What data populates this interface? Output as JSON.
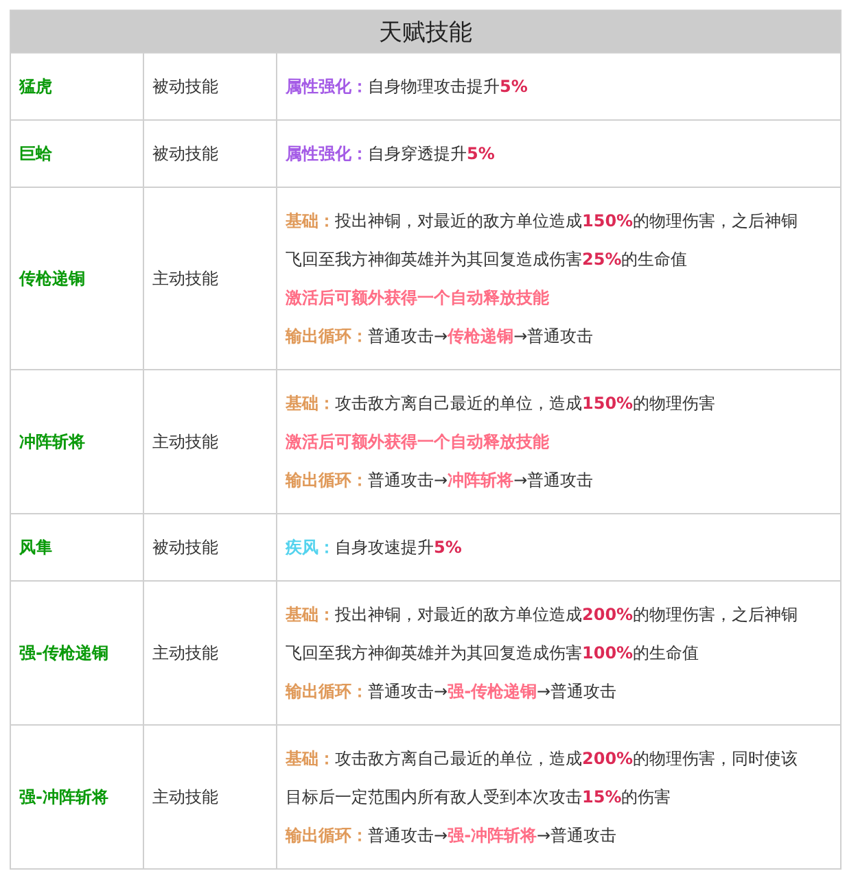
{
  "table": {
    "title": "天赋技能",
    "rows": [
      {
        "name": "猛虎",
        "type": "被动技能",
        "lines": [
          [
            {
              "kind": "attribute",
              "text": "属性强化："
            },
            {
              "kind": "plain",
              "text": "自身物理攻击提升"
            },
            {
              "kind": "number",
              "text": "5%"
            }
          ]
        ]
      },
      {
        "name": "巨蛤",
        "type": "被动技能",
        "lines": [
          [
            {
              "kind": "attribute",
              "text": "属性强化："
            },
            {
              "kind": "plain",
              "text": "自身穿透提升"
            },
            {
              "kind": "number",
              "text": "5%"
            }
          ]
        ]
      },
      {
        "name": "传枪递铜",
        "type": "主动技能",
        "lines": [
          [
            {
              "kind": "label",
              "text": "基础："
            },
            {
              "kind": "plain",
              "text": "投出神铜，对最近的敌方单位造成"
            },
            {
              "kind": "number",
              "text": "150%"
            },
            {
              "kind": "plain",
              "text": "的物理伤害，之后神铜"
            }
          ],
          [
            {
              "kind": "plain",
              "text": "飞回至我方神御英雄并为其回复造成伤害"
            },
            {
              "kind": "number",
              "text": "25%"
            },
            {
              "kind": "plain",
              "text": "的生命值"
            }
          ],
          [
            {
              "kind": "bonus",
              "text": "激活后可额外获得一个自动释放技能"
            }
          ],
          [
            {
              "kind": "label",
              "text": "输出循环："
            },
            {
              "kind": "plain",
              "text": "普通攻击→"
            },
            {
              "kind": "skill",
              "text": "传枪递铜"
            },
            {
              "kind": "plain",
              "text": "→普通攻击"
            }
          ]
        ]
      },
      {
        "name": "冲阵斩将",
        "type": "主动技能",
        "lines": [
          [
            {
              "kind": "label",
              "text": "基础："
            },
            {
              "kind": "plain",
              "text": "攻击敌方离自己最近的单位，造成"
            },
            {
              "kind": "number",
              "text": "150%"
            },
            {
              "kind": "plain",
              "text": "的物理伤害"
            }
          ],
          [
            {
              "kind": "bonus",
              "text": "激活后可额外获得一个自动释放技能"
            }
          ],
          [
            {
              "kind": "label",
              "text": "输出循环："
            },
            {
              "kind": "plain",
              "text": "普通攻击→"
            },
            {
              "kind": "skill",
              "text": "冲阵斩将"
            },
            {
              "kind": "plain",
              "text": "→普通攻击"
            }
          ]
        ]
      },
      {
        "name": "风隼",
        "type": "被动技能",
        "lines": [
          [
            {
              "kind": "speed",
              "text": "疾风："
            },
            {
              "kind": "plain",
              "text": "自身攻速提升"
            },
            {
              "kind": "number",
              "text": "5%"
            }
          ]
        ]
      },
      {
        "name": "强-传枪递铜",
        "type": "主动技能",
        "lines": [
          [
            {
              "kind": "label",
              "text": "基础："
            },
            {
              "kind": "plain",
              "text": "投出神铜，对最近的敌方单位造成"
            },
            {
              "kind": "number",
              "text": "200%"
            },
            {
              "kind": "plain",
              "text": "的物理伤害，之后神铜"
            }
          ],
          [
            {
              "kind": "plain",
              "text": "飞回至我方神御英雄并为其回复造成伤害"
            },
            {
              "kind": "number",
              "text": "100%"
            },
            {
              "kind": "plain",
              "text": "的生命值"
            }
          ],
          [
            {
              "kind": "label",
              "text": "输出循环："
            },
            {
              "kind": "plain",
              "text": "普通攻击→"
            },
            {
              "kind": "skill",
              "text": "强-传枪递铜"
            },
            {
              "kind": "plain",
              "text": "→普通攻击"
            }
          ]
        ]
      },
      {
        "name": "强-冲阵斩将",
        "type": "主动技能",
        "lines": [
          [
            {
              "kind": "label",
              "text": "基础："
            },
            {
              "kind": "plain",
              "text": "攻击敌方离自己最近的单位，造成"
            },
            {
              "kind": "number",
              "text": "200%"
            },
            {
              "kind": "plain",
              "text": "的物理伤害，同时使该"
            }
          ],
          [
            {
              "kind": "plain",
              "text": "目标后一定范围内所有敌人受到本次攻击"
            },
            {
              "kind": "number",
              "text": "15%"
            },
            {
              "kind": "plain",
              "text": "的伤害"
            }
          ],
          [
            {
              "kind": "label",
              "text": "输出循环："
            },
            {
              "kind": "plain",
              "text": "普通攻击→"
            },
            {
              "kind": "skill",
              "text": "强-冲阵斩将"
            },
            {
              "kind": "plain",
              "text": "→普通攻击"
            }
          ]
        ]
      }
    ]
  }
}
